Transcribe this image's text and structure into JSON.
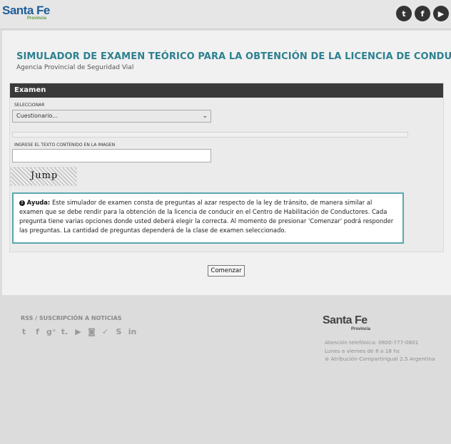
{
  "header": {
    "logo_main": "Santa Fe",
    "logo_sub": "Provincia",
    "social": [
      {
        "icon": "twitter-icon",
        "glyph": "t"
      },
      {
        "icon": "facebook-icon",
        "glyph": "f"
      },
      {
        "icon": "youtube-icon",
        "glyph": "▶"
      }
    ]
  },
  "page": {
    "title": "SIMULADOR DE EXAMEN TEÓRICO PARA LA OBTENCIÓN DE LA LICENCIA DE CONDUCIR",
    "subtitle": "Agencia Provincial de Seguridad Vial"
  },
  "exam": {
    "header": "Examen",
    "select_label": "SELECCIONAR",
    "select_value": "Cuestionario...",
    "captcha_label": "INGRESE EL TEXTO CONTENIDO EN LA IMAGEN",
    "captcha_value": "",
    "captcha_text": "Jump",
    "help_label": "Ayuda:",
    "help_text": "Este simulador de examen consta de preguntas al azar respecto de la ley de tránsito, de manera similar al examen que se debe rendir para la obtención de la licencia de conducir en el Centro de Habilitación de Conductores. Cada pregunta tiene varias opciones donde usted deberá elegir la correcta. Al momento de presionar 'Comenzar' podrá responder las preguntas. La cantidad de preguntas dependerá de la clase de examen seleccionado.",
    "start_button": "Comenzar"
  },
  "footer": {
    "rss_label": "RSS / SUSCRIPCIÓN A NOTICIAS",
    "social_icons": [
      {
        "icon": "twitter-icon",
        "glyph": "t"
      },
      {
        "icon": "facebook-icon",
        "glyph": "f"
      },
      {
        "icon": "googleplus-icon",
        "glyph": "g⁺"
      },
      {
        "icon": "tumblr-icon",
        "glyph": "t."
      },
      {
        "icon": "youtube-icon",
        "glyph": "▶"
      },
      {
        "icon": "instagram-icon",
        "glyph": "◙"
      },
      {
        "icon": "delicious-icon",
        "glyph": "✓"
      },
      {
        "icon": "flickr-icon",
        "glyph": "S"
      },
      {
        "icon": "linkedin-icon",
        "glyph": "in"
      }
    ],
    "logo_main": "Santa Fe",
    "logo_sub": "Provincia",
    "phone": "Atención telefónica: 0800-777-0801",
    "hours": "Lunes a viernes de 8 a 18 hs",
    "license": "Atribución-CompartirIgual 2.5 Argentina"
  }
}
